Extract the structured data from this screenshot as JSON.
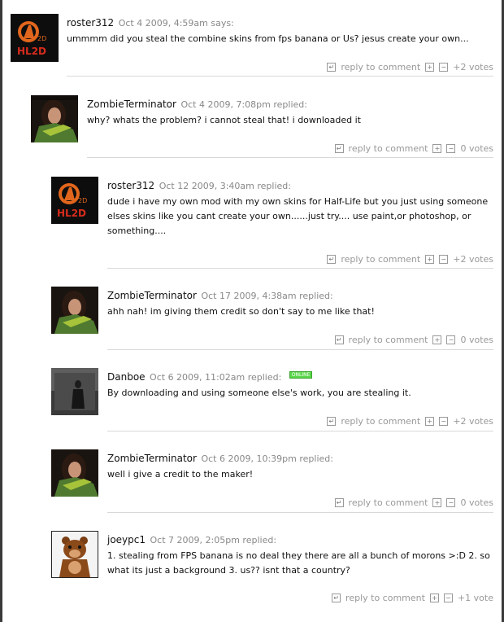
{
  "comments": [
    {
      "author": "roster312",
      "date": "Oct 4 2009, 4:59am",
      "verb": "says:",
      "text": "ummmm did you steal the combine skins from fps banana or Us? jesus create your own...",
      "reply_label": "reply to comment",
      "votes": "+2 votes",
      "avatar": "hl2d-logo"
    },
    {
      "author": "ZombieTerminator",
      "date": "Oct 4 2009, 7:08pm",
      "verb": "replied:",
      "text": "why? whats the problem? i cannot steal that! i downloaded it",
      "reply_label": "reply to comment",
      "votes": "0 votes",
      "avatar": "woman-portrait"
    },
    {
      "author": "roster312",
      "date": "Oct 12 2009, 3:40am",
      "verb": "replied:",
      "text": "dude i have my own mod with my own skins for Half-Life but you just using someone elses skins like you cant create your own......just try.... use paint,or photoshop, or something....",
      "reply_label": "reply to comment",
      "votes": "+2 votes",
      "avatar": "hl2d-logo"
    },
    {
      "author": "ZombieTerminator",
      "date": "Oct 17 2009, 4:38am",
      "verb": "replied:",
      "text": "ahh nah! im giving them credit so don't say to me like that!",
      "reply_label": "reply to comment",
      "votes": "0 votes",
      "avatar": "woman-portrait"
    },
    {
      "author": "Danboe",
      "date": "Oct 6 2009, 11:02am",
      "verb": "replied:",
      "online": "ONLINE",
      "text": "By downloading and using someone else's work, you are stealing it.",
      "reply_label": "reply to comment",
      "votes": "+2 votes",
      "avatar": "dark-figure"
    },
    {
      "author": "ZombieTerminator",
      "date": "Oct 6 2009, 10:39pm",
      "verb": "replied:",
      "text": "well i give a credit to the maker!",
      "reply_label": "reply to comment",
      "votes": "0 votes",
      "avatar": "woman-portrait"
    },
    {
      "author": "joeypc1",
      "date": "Oct 7 2009, 2:05pm",
      "verb": "replied:",
      "text": "1. stealing from FPS banana is no deal they there are all a bunch of morons >:D 2. so what its just a background 3. us?? isnt that a country?",
      "reply_label": "reply to comment",
      "votes": "+1 vote",
      "avatar": "bear-mascot"
    }
  ],
  "colors": {
    "author": "#111111",
    "meta": "#888888",
    "online_badge": "#5bd64a",
    "separator": "#d9d9d9"
  },
  "icons": {
    "reply": "reply-arrow-icon",
    "vote_up": "plus-box-icon",
    "vote_down": "minus-box-icon"
  }
}
